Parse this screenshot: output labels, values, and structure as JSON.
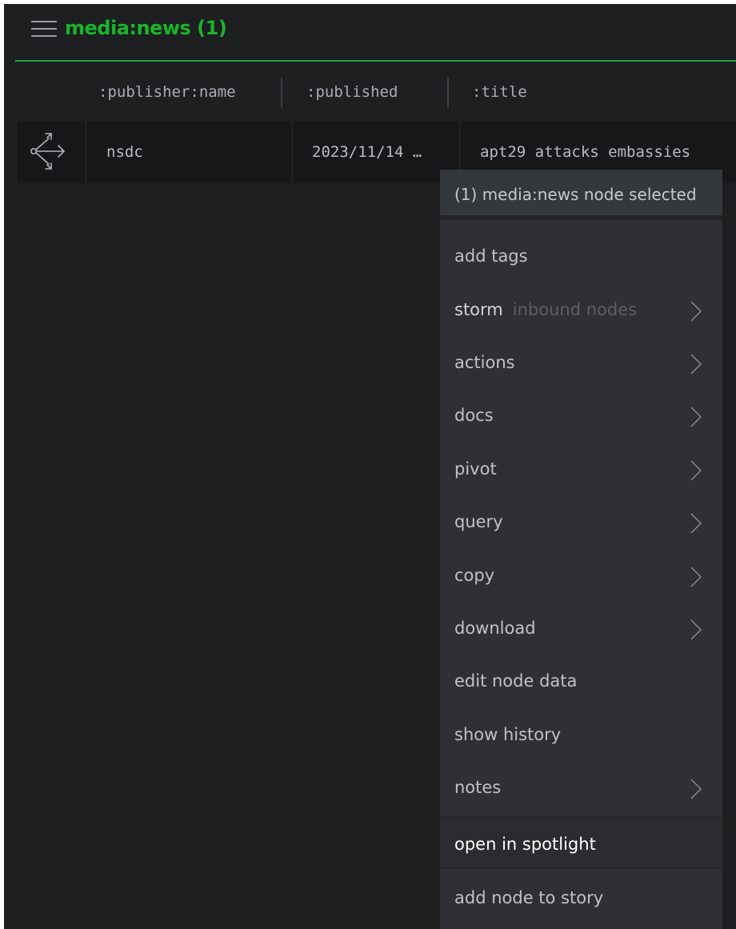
{
  "header": {
    "title": "media:news (1)",
    "title_color": "#18b52a",
    "menu_icon": "hamburger-menu-icon"
  },
  "table": {
    "columns": [
      ":publisher:name",
      ":published",
      ":title"
    ],
    "rows": [
      {
        "icon": "news-node-icon",
        "publisher": "nsdc",
        "published": "2023/11/14 …",
        "title": "apt29 attacks embassies"
      }
    ]
  },
  "context_menu": {
    "header": "(1) media:news node selected",
    "items": [
      {
        "label": "add tags"
      },
      {
        "label": "storm",
        "sublabel": "inbound nodes",
        "submenu": true
      },
      {
        "label": "actions",
        "submenu": true
      },
      {
        "label": "docs",
        "submenu": true
      },
      {
        "label": "pivot",
        "submenu": true
      },
      {
        "label": "query",
        "submenu": true
      },
      {
        "label": "copy",
        "submenu": true
      },
      {
        "label": "download",
        "submenu": true
      },
      {
        "label": "edit node data"
      },
      {
        "label": "show history"
      },
      {
        "label": "notes",
        "submenu": true
      },
      {
        "label": "open in spotlight",
        "highlighted": true
      },
      {
        "label": "add node to story"
      }
    ]
  }
}
